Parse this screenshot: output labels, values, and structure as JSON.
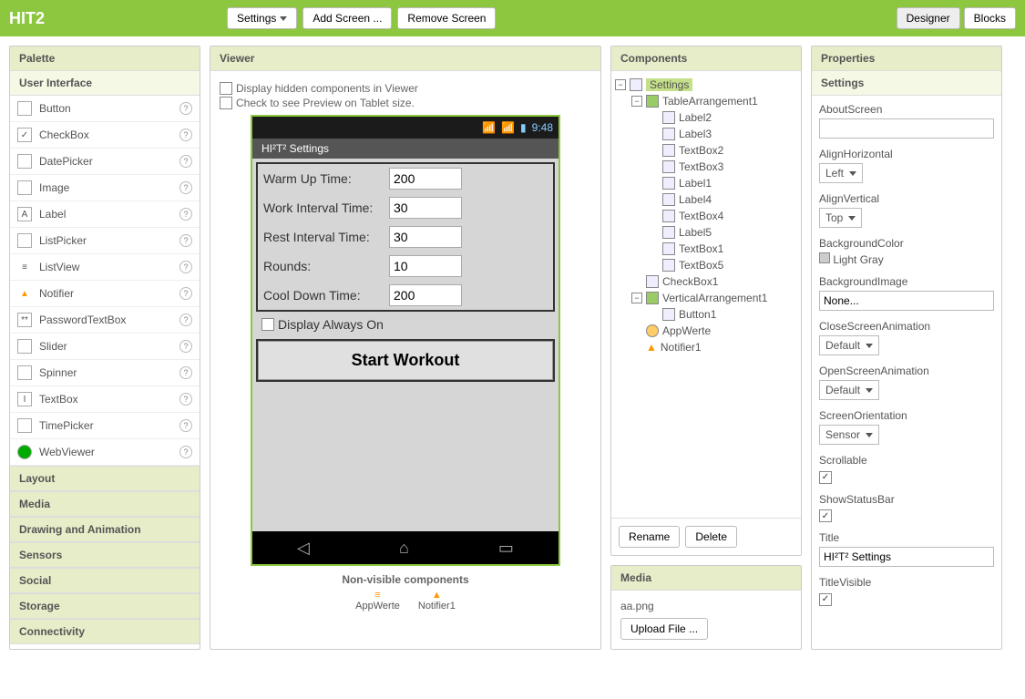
{
  "app_title": "HIT2",
  "topbar": {
    "settings": "Settings",
    "add_screen": "Add Screen ...",
    "remove_screen": "Remove Screen",
    "designer": "Designer",
    "blocks": "Blocks"
  },
  "palette": {
    "title": "Palette",
    "active_cat": "User Interface",
    "items": [
      {
        "label": "Button"
      },
      {
        "label": "CheckBox"
      },
      {
        "label": "DatePicker"
      },
      {
        "label": "Image"
      },
      {
        "label": "Label"
      },
      {
        "label": "ListPicker"
      },
      {
        "label": "ListView"
      },
      {
        "label": "Notifier"
      },
      {
        "label": "PasswordTextBox"
      },
      {
        "label": "Slider"
      },
      {
        "label": "Spinner"
      },
      {
        "label": "TextBox"
      },
      {
        "label": "TimePicker"
      },
      {
        "label": "WebViewer"
      }
    ],
    "cats": [
      "Layout",
      "Media",
      "Drawing and Animation",
      "Sensors",
      "Social",
      "Storage",
      "Connectivity"
    ]
  },
  "viewer": {
    "title": "Viewer",
    "chk_hidden": "Display hidden components in Viewer",
    "chk_tablet": "Check to see Preview on Tablet size.",
    "clock": "9:48",
    "screen_title": "HI²T² Settings",
    "rows": [
      {
        "label": "Warm Up Time:",
        "value": "200"
      },
      {
        "label": "Work Interval Time:",
        "value": "30"
      },
      {
        "label": "Rest Interval Time:",
        "value": "30"
      },
      {
        "label": "Rounds:",
        "value": "10"
      },
      {
        "label": "Cool Down Time:",
        "value": "200"
      }
    ],
    "display_always": "Display Always On",
    "start": "Start Workout",
    "nonvis_title": "Non-visible components",
    "nv": [
      "AppWerte",
      "Notifier1"
    ]
  },
  "components": {
    "title": "Components",
    "tree": {
      "root": "Settings",
      "children": [
        {
          "name": "TableArrangement1",
          "children": [
            "Label2",
            "Label3",
            "TextBox2",
            "TextBox3",
            "Label1",
            "Label4",
            "TextBox4",
            "Label5",
            "TextBox1",
            "TextBox5"
          ]
        },
        {
          "name": "CheckBox1"
        },
        {
          "name": "VerticalArrangement1",
          "children": [
            "Button1"
          ]
        },
        {
          "name": "AppWerte"
        },
        {
          "name": "Notifier1"
        }
      ]
    },
    "rename": "Rename",
    "delete": "Delete"
  },
  "media": {
    "title": "Media",
    "file": "aa.png",
    "upload": "Upload File ..."
  },
  "properties": {
    "title": "Properties",
    "for": "Settings",
    "rows": {
      "about_label": "AboutScreen",
      "about_value": "",
      "alignh_label": "AlignHorizontal",
      "alignh_value": "Left",
      "alignv_label": "AlignVertical",
      "alignv_value": "Top",
      "bgcolor_label": "BackgroundColor",
      "bgcolor_value": "Light Gray",
      "bgimg_label": "BackgroundImage",
      "bgimg_value": "None...",
      "close_label": "CloseScreenAnimation",
      "close_value": "Default",
      "open_label": "OpenScreenAnimation",
      "open_value": "Default",
      "orient_label": "ScreenOrientation",
      "orient_value": "Sensor",
      "scroll_label": "Scrollable",
      "status_label": "ShowStatusBar",
      "title_label": "Title",
      "title_value": "HI²T² Settings",
      "tvis_label": "TitleVisible"
    }
  }
}
